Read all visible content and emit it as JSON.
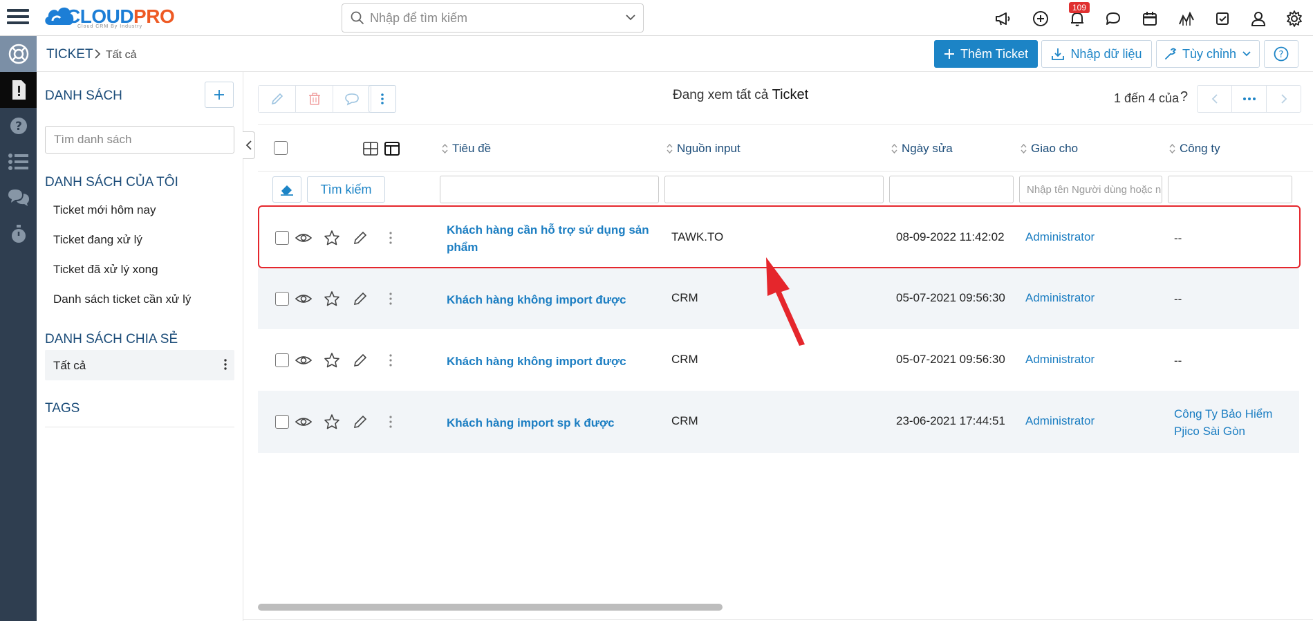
{
  "brand": {
    "name_part1": "CLOUD",
    "name_part2": "PRO",
    "tagline": "Cloud CRM By Industry"
  },
  "search": {
    "placeholder": "Nhập để tìm kiếm",
    "value": ""
  },
  "header_icons": [
    "megaphone-icon",
    "plus-circle-icon",
    "bell-icon",
    "chat-icon",
    "calendar-icon",
    "chart-icon",
    "checkbox-icon",
    "user-icon",
    "gear-icon"
  ],
  "notifications": {
    "count": "109"
  },
  "colors": {
    "rail": "#2f3e50",
    "primary": "#1c84c6",
    "link": "#1c7ec2",
    "heading": "#1a4b78",
    "highlight": "#e5262c",
    "badge": "#e03131"
  },
  "breadcrumb": {
    "root": "TICKET",
    "current": "Tất cả"
  },
  "actions": {
    "add_ticket": "Thêm Ticket",
    "import": "Nhập dữ liệu",
    "customize": "Tùy chỉnh"
  },
  "list_panel": {
    "title": "DANH SÁCH",
    "search_placeholder": "Tìm danh sách",
    "my_lists_title": "DANH SÁCH CỦA TÔI",
    "my_lists": [
      "Ticket mới hôm nay",
      "Ticket đang xử lý",
      "Ticket đã xử lý xong",
      "Danh sách ticket cần xử lý"
    ],
    "shared_title": "DANH SÁCH CHIA SẺ",
    "shared_selected": "Tất cả",
    "tags_title": "TAGS"
  },
  "view": {
    "prefix": "Đang xem tất cả",
    "entity": "Ticket"
  },
  "pagination": {
    "text": "1 đến 4 của",
    "unknown_total": "?"
  },
  "table": {
    "columns": [
      "Tiêu đề",
      "Nguồn input",
      "Ngày sửa",
      "Giao cho",
      "Công ty"
    ],
    "filter_search_label": "Tìm kiếm",
    "assignee_filter_placeholder": "Nhập tên Người dùng hoặc nhóm",
    "rows": [
      {
        "title": "Khách hàng cần hỗ trợ sử dụng sản phẩm",
        "source": "TAWK.TO",
        "modified": "08-09-2022 11:42:02",
        "assignee": "Administrator",
        "company": "--"
      },
      {
        "title": "Khách hàng không import được",
        "source": "CRM",
        "modified": "05-07-2021 09:56:30",
        "assignee": "Administrator",
        "company": "--"
      },
      {
        "title": "Khách hàng không import được",
        "source": "CRM",
        "modified": "05-07-2021 09:56:30",
        "assignee": "Administrator",
        "company": "--"
      },
      {
        "title": "Khách hàng import sp k được",
        "source": "CRM",
        "modified": "23-06-2021 17:44:51",
        "assignee": "Administrator",
        "company": "Công Ty Bảo Hiểm Pjico Sài Gòn"
      }
    ]
  }
}
